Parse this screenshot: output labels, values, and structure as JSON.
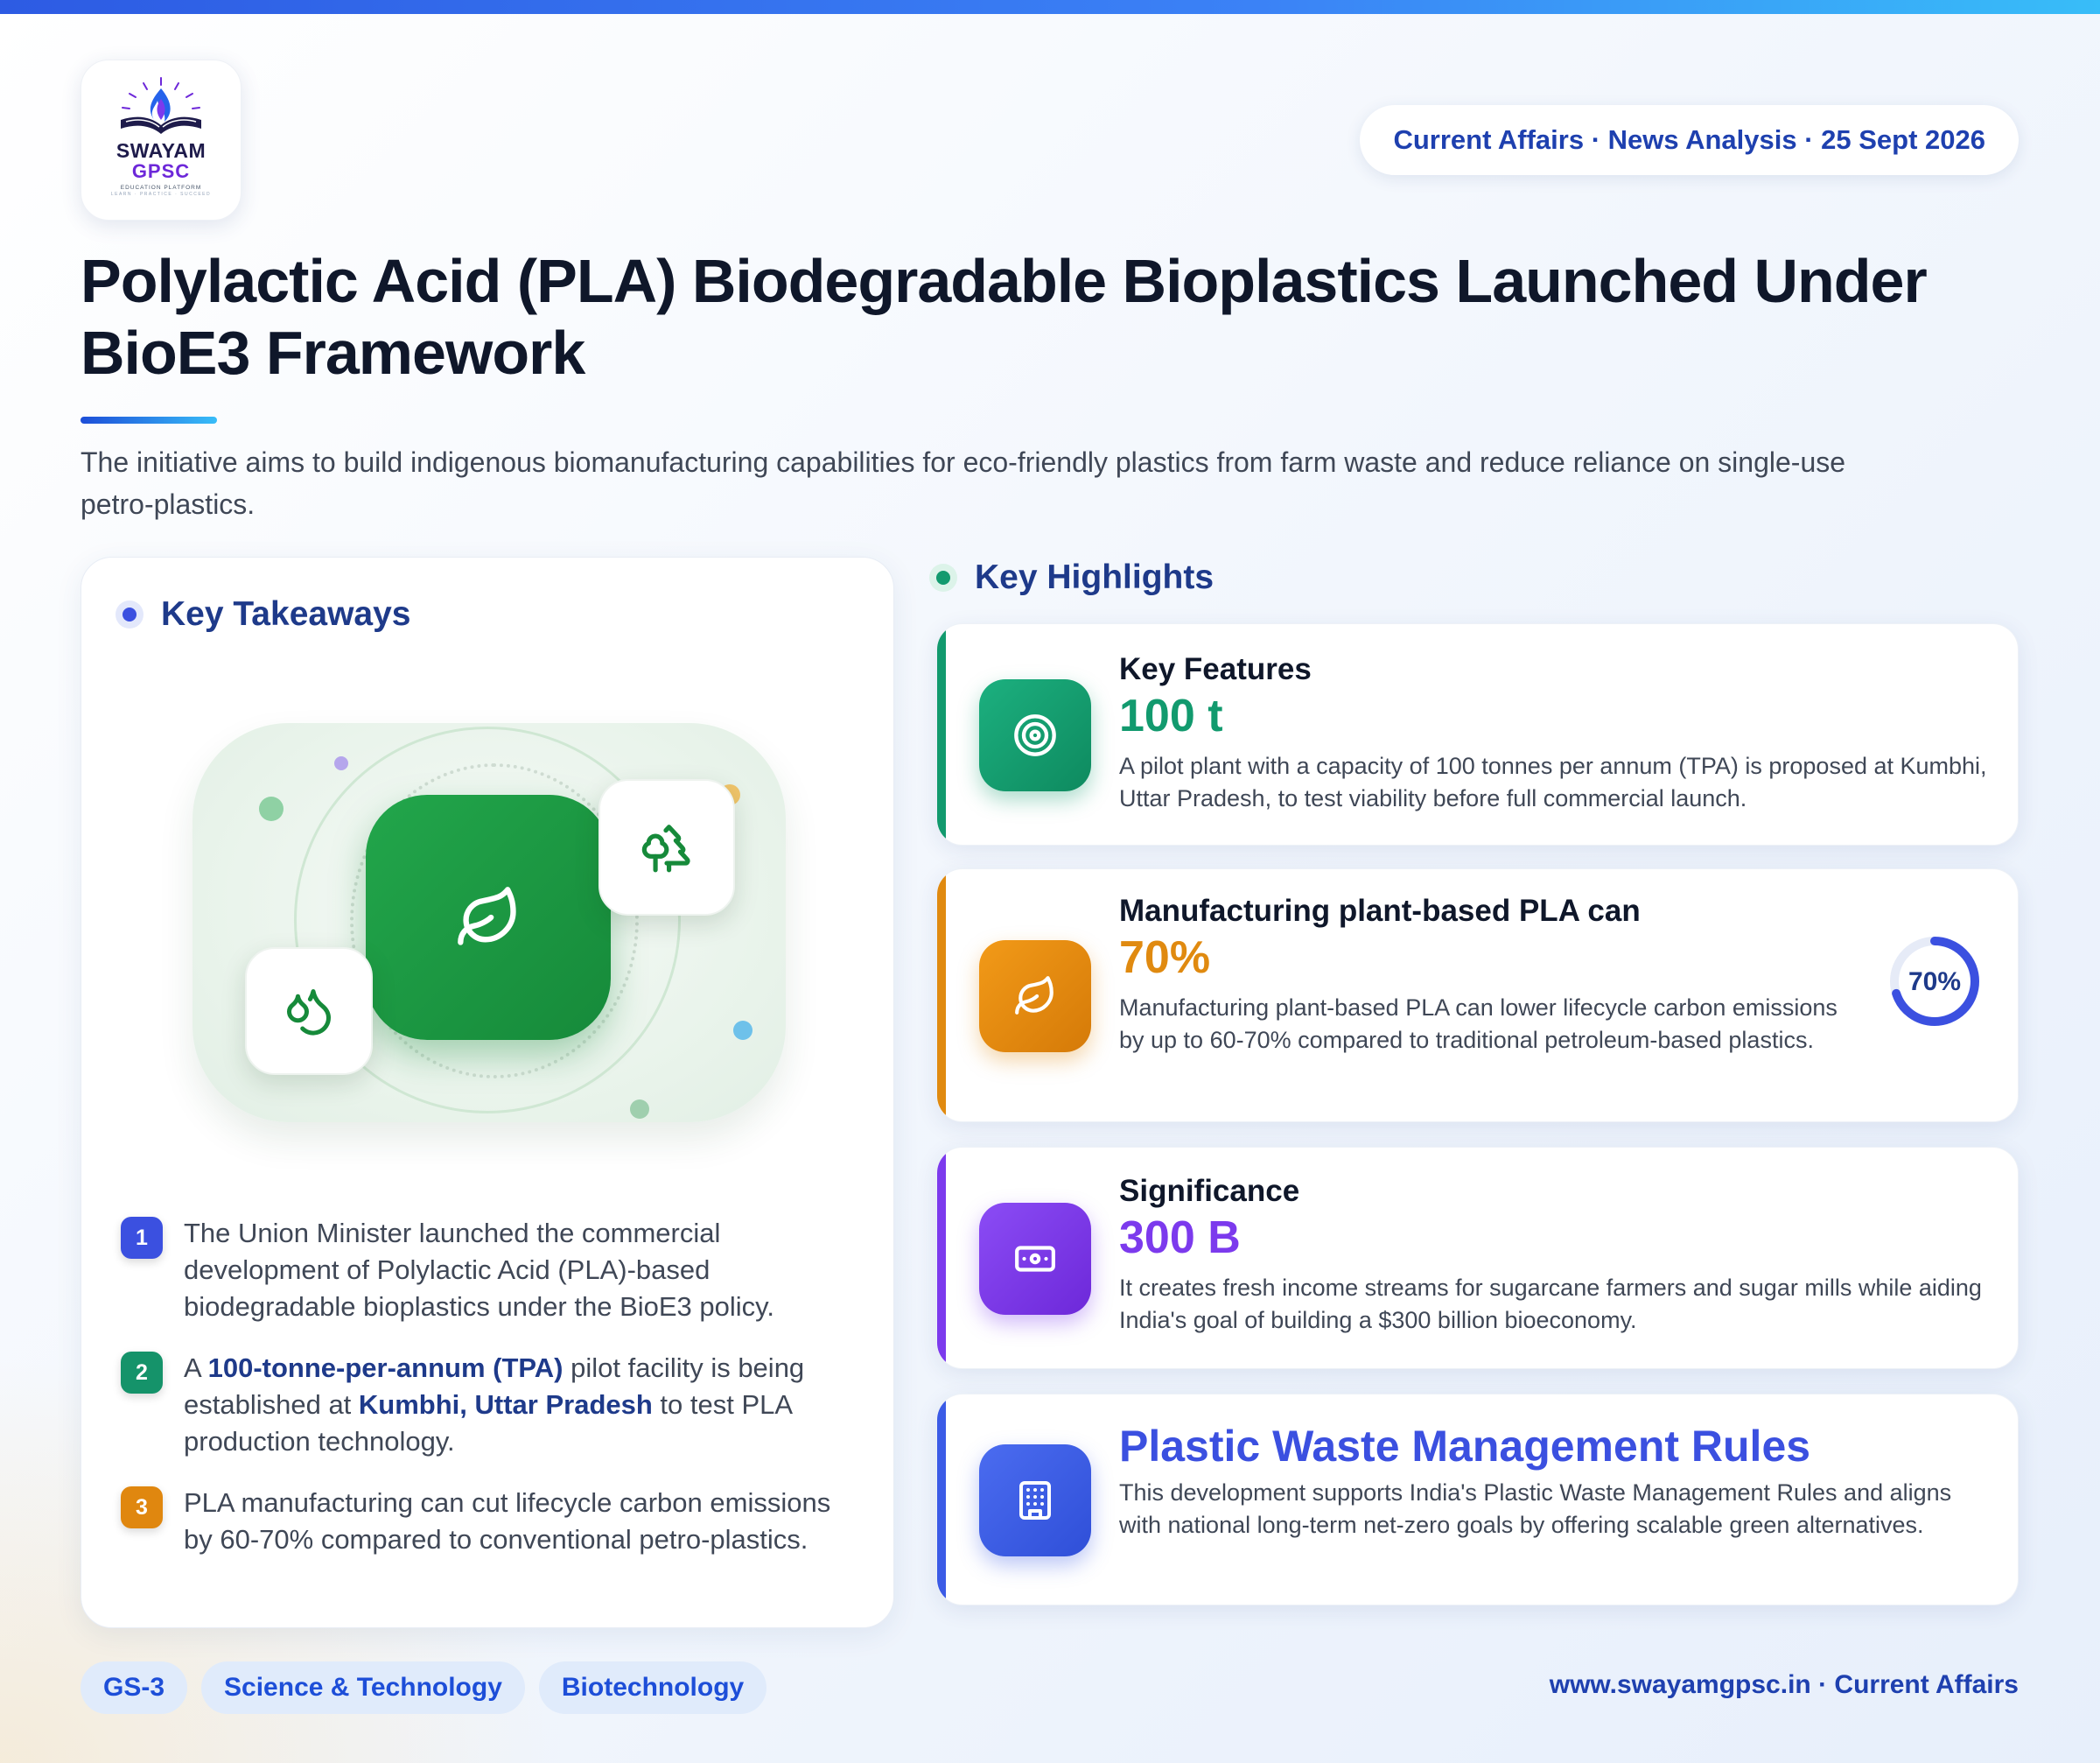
{
  "brand": {
    "logo_line1": "SWAYAM",
    "logo_line2": "GPSC",
    "logo_line3": "EDUCATION PLATFORM",
    "logo_line4": "LEARN · PRACTICE · SUCCEED"
  },
  "header": {
    "date_pill": "Current Affairs · News Analysis · 25 Sept 2026",
    "title": "Polylactic Acid (PLA) Biodegradable Bioplastics Launched Under BioE3 Framework",
    "subtitle": "The initiative aims to build indigenous biomanufacturing capabilities for eco-friendly plastics from farm waste and reduce reliance on single-use petro-plastics."
  },
  "takeaways": {
    "heading": "Key Takeaways",
    "illustration_icons": [
      "leaf-icon",
      "trees-icon",
      "droplets-icon"
    ],
    "items": [
      {
        "num": "1",
        "color": "#3b50e0",
        "parts": [
          {
            "t": "The Union Minister launched the commercial development of Polylactic Acid (PLA)-based biodegradable bioplastics under the BioE3 policy.",
            "b": false
          }
        ]
      },
      {
        "num": "2",
        "color": "#15936a",
        "parts": [
          {
            "t": "A ",
            "b": false
          },
          {
            "t": "100-tonne-per-annum (TPA)",
            "b": true
          },
          {
            "t": " pilot facility is being established at ",
            "b": false
          },
          {
            "t": "Kumbhi, Uttar Pradesh",
            "b": true
          },
          {
            "t": " to test PLA production technology.",
            "b": false
          }
        ]
      },
      {
        "num": "3",
        "color": "#e0870f",
        "parts": [
          {
            "t": "PLA manufacturing can cut lifecycle carbon emissions by 60-70% compared to conventional petro-plastics.",
            "b": false
          }
        ]
      }
    ]
  },
  "highlights": {
    "heading": "Key Highlights",
    "cards": [
      {
        "label": "Key Features",
        "value": "100 t",
        "desc": "A pilot plant with a capacity of 100 tonnes per annum (TPA) is proposed at Kumbhi, Uttar Pradesh, to test viability before full commercial launch.",
        "color": "#129a6e",
        "icon": "target-icon"
      },
      {
        "label": "Manufacturing plant-based PLA can",
        "value": "70%",
        "desc": "Manufacturing plant-based PLA can lower lifecycle carbon emissions by up to 60-70% compared to traditional petroleum-based plastics.",
        "color": "#e08a10",
        "icon": "leaf-icon",
        "gauge_label": "70%",
        "gauge_fraction": 0.7
      },
      {
        "label": "Significance",
        "value": "300 B",
        "desc": "It creates fresh income streams for sugarcane farmers and sugar mills while aiding India's goal of building a $300 billion bioeconomy.",
        "color": "#7c3aed",
        "icon": "banknote-icon"
      },
      {
        "label": "",
        "value": "Plastic Waste Management Rules",
        "desc": "This development supports India's Plastic Waste Management Rules and aligns with national long-term net-zero goals by offering scalable green alternatives.",
        "color": "#3b5be6",
        "icon": "building-icon"
      }
    ]
  },
  "footer": {
    "tags": [
      "GS-3",
      "Science & Technology",
      "Biotechnology"
    ],
    "site": "www.swayamgpsc.in · Current Affairs"
  },
  "colors": {
    "accent_blue": "#1d4ed8",
    "green": "#168a3a",
    "title": "#0f172a"
  }
}
